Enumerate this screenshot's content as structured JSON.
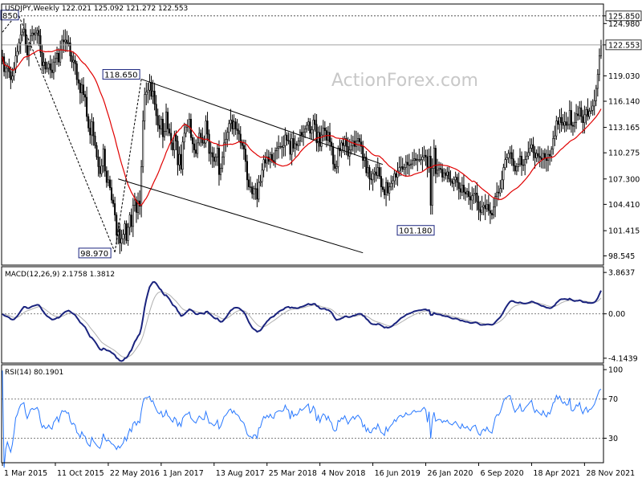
{
  "header": {
    "main": "USDJPY,Weekly  122.021 125.092 121.272 122.553",
    "macd": "MACD(12,26,9) 2.1758 1.3812",
    "rsi": "RSI(14) 80.1901"
  },
  "watermark": "ActionForex.com",
  "colors": {
    "candle": "#000000",
    "ma": "#e00000",
    "macd_line": "#1a237e",
    "macd_signal": "#b0b0b0",
    "rsi": "#2878ff",
    "trendline": "#000000",
    "grid_dotted": "#808080",
    "price_line": "#a0a0a0",
    "label_border": "#1a237e"
  },
  "chart_data": [
    {
      "type": "candlestick",
      "title": "USDJPY,Weekly",
      "ohlc_last": {
        "open": 122.021,
        "high": 125.092,
        "low": 121.272,
        "close": 122.553
      },
      "ylim": [
        97.5,
        127.2
      ],
      "y_ticks": [
        98.545,
        101.415,
        104.41,
        107.3,
        110.275,
        113.165,
        116.14,
        119.03,
        122.553,
        124.98,
        125.85
      ],
      "x_ticks": [
        "1 Mar 2015",
        "11 Oct 2015",
        "22 May 2016",
        "1 Jan 2017",
        "13 Aug 2017",
        "25 Mar 2018",
        "4 Nov 2018",
        "16 Jun 2019",
        "26 Jan 2020",
        "6 Sep 2020",
        "18 Apr 2021",
        "28 Nov 2021"
      ],
      "current_price": 122.553,
      "resistance_level": 125.85,
      "annotations": [
        {
          "text": "118.650",
          "value": 118.65
        },
        {
          "text": "98.970",
          "value": 98.97
        },
        {
          "text": "101.180",
          "value": 101.18
        },
        {
          "text": "850",
          "value": 125.85
        }
      ],
      "close_series": [
        121.2,
        119.5,
        119.9,
        120.1,
        119.5,
        118.6,
        119.0,
        119.8,
        121.3,
        121.8,
        122.8,
        123.7,
        124.0,
        124.3,
        122.5,
        121.4,
        122.4,
        123.6,
        123.9,
        123.7,
        123.9,
        124.2,
        123.6,
        121.7,
        120.2,
        120.6,
        119.8,
        119.9,
        120.4,
        119.7,
        119.4,
        120.6,
        121.0,
        121.6,
        120.6,
        122.0,
        123.1,
        122.9,
        123.1,
        122.7,
        122.8,
        121.3,
        120.6,
        120.8,
        120.4,
        118.6,
        118.2,
        117.1,
        118.0,
        116.9,
        116.6,
        114.4,
        113.1,
        112.3,
        113.8,
        112.2,
        111.1,
        109.8,
        108.7,
        107.9,
        108.8,
        110.7,
        108.2,
        106.9,
        107.2,
        106.3,
        104.9,
        104.5,
        103.2,
        100.9,
        101.6,
        100.0,
        100.5,
        101.0,
        102.2,
        100.3,
        101.8,
        103.2,
        101.9,
        104.3,
        104.9,
        103.5,
        104.8,
        104.2,
        108.7,
        113.9,
        116.9,
        117.2,
        117.4,
        118.3,
        116.7,
        117.3,
        115.8,
        114.5,
        113.4,
        113.0,
        114.1,
        112.1,
        112.7,
        114.9,
        113.0,
        112.5,
        111.4,
        110.6,
        112.3,
        111.6,
        108.9,
        110.1,
        108.4,
        111.5,
        112.5,
        113.2,
        113.3,
        114.1,
        112.0,
        111.3,
        110.6,
        110.2,
        111.4,
        112.5,
        112.0,
        111.4,
        111.4,
        113.9,
        112.4,
        110.2,
        110.3,
        109.8,
        109.3,
        109.8,
        110.8,
        107.8,
        108.5,
        109.8,
        111.4,
        111.8,
        112.6,
        113.6,
        114.0,
        113.0,
        113.8,
        113.0,
        112.8,
        112.4,
        111.4,
        111.1,
        110.7,
        109.3,
        107.2,
        106.4,
        106.4,
        105.6,
        106.2,
        106.2,
        105.0,
        106.9,
        107.0,
        108.3,
        109.5,
        109.1,
        109.8,
        109.3,
        110.1,
        109.4,
        109.2,
        110.5,
        110.8,
        111.0,
        111.0,
        110.9,
        111.1,
        112.3,
        111.7,
        111.6,
        110.1,
        111.9,
        110.8,
        111.3,
        111.1,
        111.6,
        112.6,
        112.3,
        112.6,
        113.0,
        113.4,
        113.8,
        112.5,
        112.9,
        114.0,
        113.5,
        111.4,
        112.6,
        111.0,
        112.3,
        113.1,
        112.8,
        111.7,
        112.6,
        111.5,
        111.0,
        109.0,
        108.5,
        108.7,
        110.8,
        110.5,
        111.4,
        111.1,
        111.9,
        111.0,
        109.9,
        110.6,
        111.1,
        111.6,
        111.0,
        111.6,
        111.9,
        111.5,
        111.0,
        109.4,
        109.8,
        108.0,
        108.6,
        107.3,
        107.2,
        107.9,
        108.1,
        107.7,
        108.6,
        107.6,
        106.4,
        106.1,
        105.5,
        106.9,
        105.7,
        106.4,
        106.8,
        107.1,
        107.9,
        107.5,
        108.2,
        108.6,
        108.7,
        108.4,
        108.6,
        109.2,
        108.9,
        108.9,
        109.0,
        109.4,
        109.6,
        109.4,
        109.5,
        109.5,
        109.5,
        109.8,
        110.0,
        109.8,
        108.6,
        109.9,
        104.3,
        108.5,
        110.8,
        107.9,
        108.3,
        108.5,
        108.4,
        107.5,
        108.0,
        107.7,
        108.1,
        107.3,
        107.0,
        106.8,
        107.2,
        107.5,
        106.9,
        106.2,
        105.8,
        106.6,
        105.8,
        105.6,
        105.9,
        105.3,
        104.9,
        105.4,
        105.6,
        105.7,
        104.7,
        103.8,
        103.5,
        104.1,
        104.3,
        103.9,
        104.4,
        103.7,
        103.4,
        103.2,
        104.1,
        105.3,
        105.8,
        105.7,
        106.2,
        107.2,
        108.6,
        109.5,
        109.7,
        110.2,
        110.3,
        109.6,
        108.8,
        108.2,
        108.7,
        109.0,
        109.9,
        108.9,
        108.9,
        109.5,
        109.9,
        110.3,
        110.8,
        111.2,
        110.3,
        109.7,
        110.2,
        109.9,
        109.7,
        109.5,
        110.2,
        109.7,
        109.4,
        110.1,
        109.9,
        110.7,
        111.9,
        112.2,
        113.9,
        113.5,
        114.3,
        113.7,
        113.4,
        113.8,
        113.4,
        113.5,
        115.1,
        113.4,
        113.3,
        113.7,
        114.7,
        114.5,
        115.4,
        114.4,
        113.7,
        114.6,
        115.2,
        114.4,
        115.0,
        115.1,
        115.6,
        116.2,
        117.6,
        119.2,
        121.3,
        122.55
      ],
      "series": [
        {
          "name": "USDJPY,Weekly"
        },
        {
          "name": "MACD(12,26,9)",
          "values_last": [
            2.1758,
            1.3812
          ]
        },
        {
          "name": "RSI(14)",
          "value_last": 80.1901
        }
      ]
    },
    {
      "type": "line",
      "title": "MACD(12,26,9) 2.1758 1.3812",
      "ylim": [
        -4.6,
        4.4
      ],
      "y_ticks": [
        3.8637,
        0.0,
        -4.1439
      ],
      "macd_last": 2.1758,
      "signal_last": 1.3812
    },
    {
      "type": "line",
      "title": "RSI(14) 80.1901",
      "ylim": [
        5,
        105
      ],
      "y_ticks": [
        100,
        70,
        30
      ],
      "rsi_last": 80.1901
    }
  ]
}
